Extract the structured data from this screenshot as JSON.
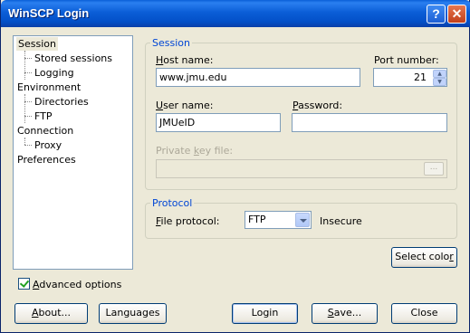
{
  "window": {
    "title": "WinSCP Login",
    "help_glyph": "?",
    "close_glyph": "✕"
  },
  "tree": {
    "items": [
      {
        "label": "Session",
        "selected": true
      },
      {
        "label": "Stored sessions"
      },
      {
        "label": "Logging"
      },
      {
        "label": "Environment"
      },
      {
        "label": "Directories"
      },
      {
        "label": "FTP"
      },
      {
        "label": "Connection"
      },
      {
        "label": "Proxy"
      },
      {
        "label": "Preferences"
      }
    ]
  },
  "session": {
    "legend": "Session",
    "host_label": "ost name:",
    "host_label_u": "H",
    "host_value": "www.jmu.edu",
    "port_label": "Port number:",
    "port_value": "21",
    "user_label_u": "U",
    "user_label": "ser name:",
    "user_value": "JMUeID",
    "password_label_u": "P",
    "password_label": "assword:",
    "password_value": "",
    "keyfile_label_a": "Private ",
    "keyfile_label_u": "k",
    "keyfile_label_b": "ey file:",
    "keyfile_value": "",
    "browse_label": "..."
  },
  "protocol": {
    "legend": "Protocol",
    "file_protocol_label_u": "F",
    "file_protocol_label": "ile protocol:",
    "selected": "FTP",
    "security_note": "Insecure"
  },
  "select_color": {
    "label_a": "Select colo",
    "label_u": "r"
  },
  "advanced": {
    "label_u": "A",
    "label": "dvanced options",
    "checked": true
  },
  "buttons": {
    "about_u": "A",
    "about": "bout...",
    "languages": "Languages",
    "login": "Login",
    "save_u": "S",
    "save": "ave...",
    "close": "Close"
  }
}
